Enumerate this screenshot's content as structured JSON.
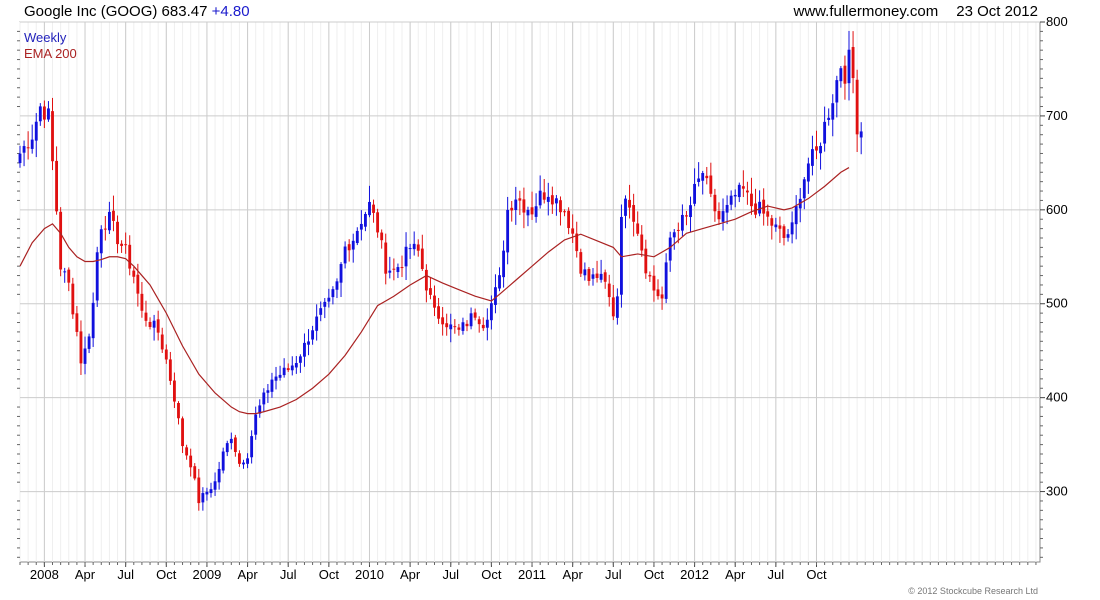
{
  "header": {
    "title": "Google Inc (GOOG)",
    "last": "683.47",
    "change": "+4.80",
    "site": "www.fullermoney.com",
    "date": "23 Oct 2012"
  },
  "footer": {
    "copyright": "© 2012 Stockcube Research Ltd"
  },
  "chart_data": {
    "type": "candlestick",
    "legend": [
      {
        "label": "Weekly",
        "color": "#2222bb"
      },
      {
        "label": "EMA 200",
        "color": "#aa2222"
      }
    ],
    "colors": {
      "up": "#1010dd",
      "down": "#e01010",
      "ema": "#aa2222",
      "grid": "#cccccc"
    },
    "ylim": [
      225,
      800
    ],
    "yticks": [
      300,
      400,
      500,
      600,
      700,
      800
    ],
    "xlim": [
      0,
      251
    ],
    "xticks": [
      {
        "label": "2008",
        "i": 6
      },
      {
        "label": "Apr",
        "i": 16
      },
      {
        "label": "Jul",
        "i": 26
      },
      {
        "label": "Oct",
        "i": 36
      },
      {
        "label": "2009",
        "i": 46
      },
      {
        "label": "Apr",
        "i": 56
      },
      {
        "label": "Jul",
        "i": 66
      },
      {
        "label": "Oct",
        "i": 76
      },
      {
        "label": "2010",
        "i": 86
      },
      {
        "label": "Apr",
        "i": 96
      },
      {
        "label": "Jul",
        "i": 106
      },
      {
        "label": "Oct",
        "i": 116
      },
      {
        "label": "2011",
        "i": 126
      },
      {
        "label": "Apr",
        "i": 136
      },
      {
        "label": "Jul",
        "i": 146
      },
      {
        "label": "Oct",
        "i": 156
      },
      {
        "label": "2012",
        "i": 166
      },
      {
        "label": "Apr",
        "i": 176
      },
      {
        "label": "Jul",
        "i": 186
      },
      {
        "label": "Oct",
        "i": 196
      }
    ],
    "price_keypoints": [
      [
        0,
        660
      ],
      [
        3,
        680
      ],
      [
        5,
        710
      ],
      [
        7,
        700
      ],
      [
        8,
        650
      ],
      [
        9,
        600
      ],
      [
        10,
        540
      ],
      [
        12,
        520
      ],
      [
        14,
        470
      ],
      [
        15,
        440
      ],
      [
        16,
        450
      ],
      [
        17,
        470
      ],
      [
        18,
        500
      ],
      [
        19,
        555
      ],
      [
        20,
        585
      ],
      [
        22,
        590
      ],
      [
        24,
        570
      ],
      [
        26,
        555
      ],
      [
        28,
        530
      ],
      [
        30,
        490
      ],
      [
        32,
        480
      ],
      [
        34,
        470
      ],
      [
        36,
        440
      ],
      [
        38,
        400
      ],
      [
        40,
        350
      ],
      [
        42,
        330
      ],
      [
        44,
        290
      ],
      [
        46,
        300
      ],
      [
        48,
        310
      ],
      [
        50,
        340
      ],
      [
        52,
        360
      ],
      [
        54,
        330
      ],
      [
        56,
        340
      ],
      [
        58,
        380
      ],
      [
        60,
        400
      ],
      [
        62,
        420
      ],
      [
        64,
        425
      ],
      [
        66,
        430
      ],
      [
        68,
        440
      ],
      [
        70,
        455
      ],
      [
        72,
        475
      ],
      [
        74,
        490
      ],
      [
        76,
        500
      ],
      [
        78,
        520
      ],
      [
        80,
        560
      ],
      [
        82,
        570
      ],
      [
        84,
        590
      ],
      [
        86,
        605
      ],
      [
        88,
        580
      ],
      [
        90,
        540
      ],
      [
        92,
        535
      ],
      [
        94,
        545
      ],
      [
        96,
        560
      ],
      [
        98,
        555
      ],
      [
        100,
        520
      ],
      [
        102,
        490
      ],
      [
        104,
        485
      ],
      [
        106,
        475
      ],
      [
        108,
        470
      ],
      [
        110,
        480
      ],
      [
        112,
        490
      ],
      [
        114,
        480
      ],
      [
        116,
        500
      ],
      [
        118,
        525
      ],
      [
        120,
        600
      ],
      [
        122,
        615
      ],
      [
        124,
        605
      ],
      [
        126,
        600
      ],
      [
        128,
        615
      ],
      [
        130,
        620
      ],
      [
        132,
        610
      ],
      [
        134,
        600
      ],
      [
        136,
        575
      ],
      [
        138,
        540
      ],
      [
        140,
        525
      ],
      [
        142,
        530
      ],
      [
        144,
        520
      ],
      [
        146,
        490
      ],
      [
        147,
        510
      ],
      [
        148,
        600
      ],
      [
        150,
        610
      ],
      [
        152,
        580
      ],
      [
        154,
        540
      ],
      [
        156,
        515
      ],
      [
        158,
        505
      ],
      [
        160,
        570
      ],
      [
        162,
        585
      ],
      [
        164,
        590
      ],
      [
        166,
        620
      ],
      [
        168,
        640
      ],
      [
        170,
        610
      ],
      [
        172,
        590
      ],
      [
        174,
        600
      ],
      [
        176,
        615
      ],
      [
        178,
        620
      ],
      [
        180,
        605
      ],
      [
        182,
        600
      ],
      [
        184,
        590
      ],
      [
        186,
        580
      ],
      [
        188,
        570
      ],
      [
        190,
        580
      ],
      [
        192,
        620
      ],
      [
        194,
        650
      ],
      [
        196,
        660
      ],
      [
        198,
        690
      ],
      [
        200,
        720
      ],
      [
        202,
        755
      ],
      [
        203,
        745
      ],
      [
        204,
        760
      ],
      [
        205,
        740
      ],
      [
        206,
        690
      ],
      [
        207,
        683.47
      ]
    ],
    "ema_keypoints": [
      [
        0,
        540
      ],
      [
        3,
        565
      ],
      [
        6,
        580
      ],
      [
        8,
        585
      ],
      [
        10,
        575
      ],
      [
        12,
        560
      ],
      [
        14,
        550
      ],
      [
        16,
        545
      ],
      [
        18,
        545
      ],
      [
        20,
        547
      ],
      [
        22,
        550
      ],
      [
        24,
        550
      ],
      [
        26,
        548
      ],
      [
        28,
        540
      ],
      [
        30,
        530
      ],
      [
        32,
        520
      ],
      [
        34,
        505
      ],
      [
        36,
        490
      ],
      [
        40,
        455
      ],
      [
        44,
        425
      ],
      [
        48,
        405
      ],
      [
        52,
        390
      ],
      [
        54,
        385
      ],
      [
        56,
        383
      ],
      [
        58,
        383
      ],
      [
        60,
        385
      ],
      [
        64,
        390
      ],
      [
        68,
        398
      ],
      [
        72,
        410
      ],
      [
        76,
        425
      ],
      [
        80,
        445
      ],
      [
        84,
        470
      ],
      [
        88,
        498
      ],
      [
        92,
        508
      ],
      [
        96,
        520
      ],
      [
        100,
        530
      ],
      [
        104,
        522
      ],
      [
        108,
        515
      ],
      [
        112,
        508
      ],
      [
        116,
        503
      ],
      [
        118,
        510
      ],
      [
        122,
        525
      ],
      [
        126,
        540
      ],
      [
        130,
        555
      ],
      [
        134,
        568
      ],
      [
        138,
        574
      ],
      [
        142,
        567
      ],
      [
        146,
        560
      ],
      [
        148,
        550
      ],
      [
        152,
        553
      ],
      [
        156,
        550
      ],
      [
        160,
        560
      ],
      [
        164,
        575
      ],
      [
        168,
        580
      ],
      [
        172,
        585
      ],
      [
        176,
        590
      ],
      [
        180,
        598
      ],
      [
        184,
        604
      ],
      [
        188,
        600
      ],
      [
        190,
        602
      ],
      [
        194,
        612
      ],
      [
        198,
        625
      ],
      [
        202,
        640
      ],
      [
        204,
        645
      ]
    ],
    "last_price": 683.47
  }
}
